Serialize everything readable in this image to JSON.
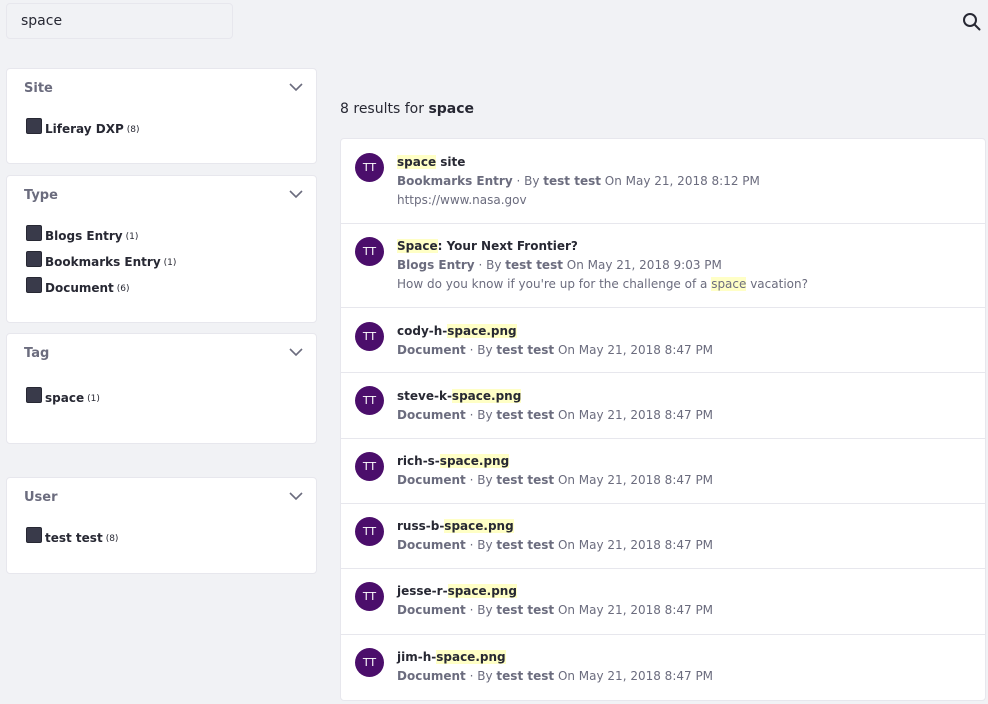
{
  "search": {
    "value": "space"
  },
  "facets": {
    "site": {
      "title": "Site",
      "items": [
        {
          "label": "Liferay DXP",
          "count": "(8)"
        }
      ]
    },
    "type": {
      "title": "Type",
      "items": [
        {
          "label": "Blogs Entry",
          "count": "(1)"
        },
        {
          "label": "Bookmarks Entry",
          "count": "(1)"
        },
        {
          "label": "Document",
          "count": "(6)"
        }
      ]
    },
    "tag": {
      "title": "Tag",
      "items": [
        {
          "label": "space",
          "count": "(1)"
        }
      ]
    },
    "user": {
      "title": "User",
      "items": [
        {
          "label": "test test",
          "count": "(8)"
        }
      ]
    }
  },
  "summary": {
    "count": "8",
    "text": "results for",
    "term": "space"
  },
  "results": [
    {
      "avatar": "TT",
      "title_hl": "space",
      "title_rest": " site",
      "type": "Bookmarks Entry",
      "by": "· By",
      "author": "test test",
      "date": "On May 21, 2018 8:12 PM",
      "desc": "https://www.nasa.gov"
    },
    {
      "avatar": "TT",
      "title_hl": "Space",
      "title_rest": ": Your Next Frontier?",
      "type": "Blogs Entry",
      "by": "· By",
      "author": "test test",
      "date": "On May 21, 2018 9:03 PM",
      "desc_pre": "How do you know if you're up for the challenge of a ",
      "desc_hl": "space",
      "desc_post": " vacation?"
    },
    {
      "avatar": "TT",
      "title_pre": "cody-h-",
      "title_hl": "space.png",
      "type": "Document",
      "by": "· By",
      "author": "test test",
      "date": "On May 21, 2018 8:47 PM"
    },
    {
      "avatar": "TT",
      "title_pre": "steve-k-",
      "title_hl": "space.png",
      "type": "Document",
      "by": "· By",
      "author": "test test",
      "date": "On May 21, 2018 8:47 PM"
    },
    {
      "avatar": "TT",
      "title_pre": "rich-s-",
      "title_hl": "space.png",
      "type": "Document",
      "by": "· By",
      "author": "test test",
      "date": "On May 21, 2018 8:47 PM"
    },
    {
      "avatar": "TT",
      "title_pre": "russ-b-",
      "title_hl": "space.png",
      "type": "Document",
      "by": "· By",
      "author": "test test",
      "date": "On May 21, 2018 8:47 PM"
    },
    {
      "avatar": "TT",
      "title_pre": "jesse-r-",
      "title_hl": "space.png",
      "type": "Document",
      "by": "· By",
      "author": "test test",
      "date": "On May 21, 2018 8:47 PM"
    },
    {
      "avatar": "TT",
      "title_pre": "jim-h-",
      "title_hl": "space.png",
      "type": "Document",
      "by": "· By",
      "author": "test test",
      "date": "On May 21, 2018 8:47 PM"
    }
  ]
}
